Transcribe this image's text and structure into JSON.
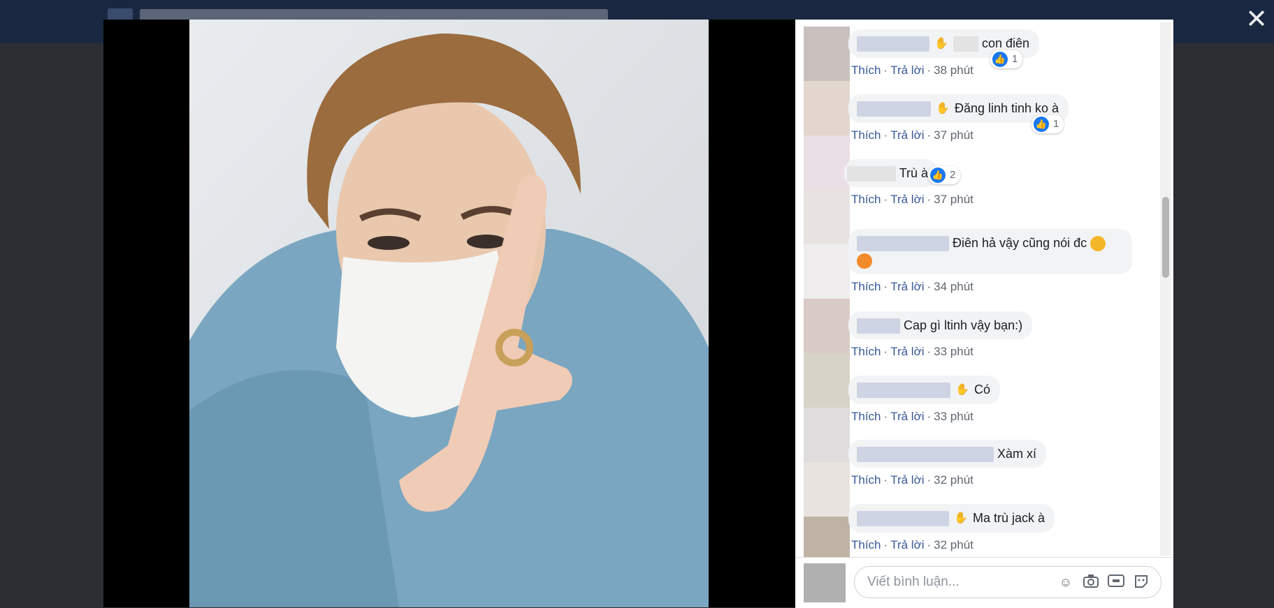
{
  "viewer": {
    "close_label": "✕"
  },
  "comments": [
    {
      "text": "con điên",
      "like": "Thích",
      "reply": "Trả lời",
      "time": "38 phút",
      "reactions": "1"
    },
    {
      "text": "Đăng linh tinh ko à",
      "like": "Thích",
      "reply": "Trả lời",
      "time": "37 phút",
      "reactions": "1"
    },
    {
      "text": "Trù à",
      "like": "Thích",
      "reply": "Trả lời",
      "time": "37 phút",
      "reactions": "2"
    },
    {
      "text": "Điên hả vậy cũng nói đc",
      "like": "Thích",
      "reply": "Trả lời",
      "time": "34 phút"
    },
    {
      "text": "Cap gì ltinh vậy bạn:)",
      "like": "Thích",
      "reply": "Trả lời",
      "time": "33 phút"
    },
    {
      "text": "Có",
      "like": "Thích",
      "reply": "Trả lời",
      "time": "33 phút"
    },
    {
      "text": "Xàm xí",
      "like": "Thích",
      "reply": "Trả lời",
      "time": "32 phút"
    },
    {
      "text": "Ma trù jack à",
      "like": "Thích",
      "reply": "Trả lời",
      "time": "32 phút"
    }
  ],
  "composer": {
    "placeholder": "Viết bình luận...",
    "icons": [
      "emoji-icon",
      "camera-icon",
      "gif-icon",
      "sticker-icon"
    ]
  },
  "colors": {
    "link": "#385898",
    "like_blue": "#1877f2",
    "bubble": "#f2f3f5"
  }
}
